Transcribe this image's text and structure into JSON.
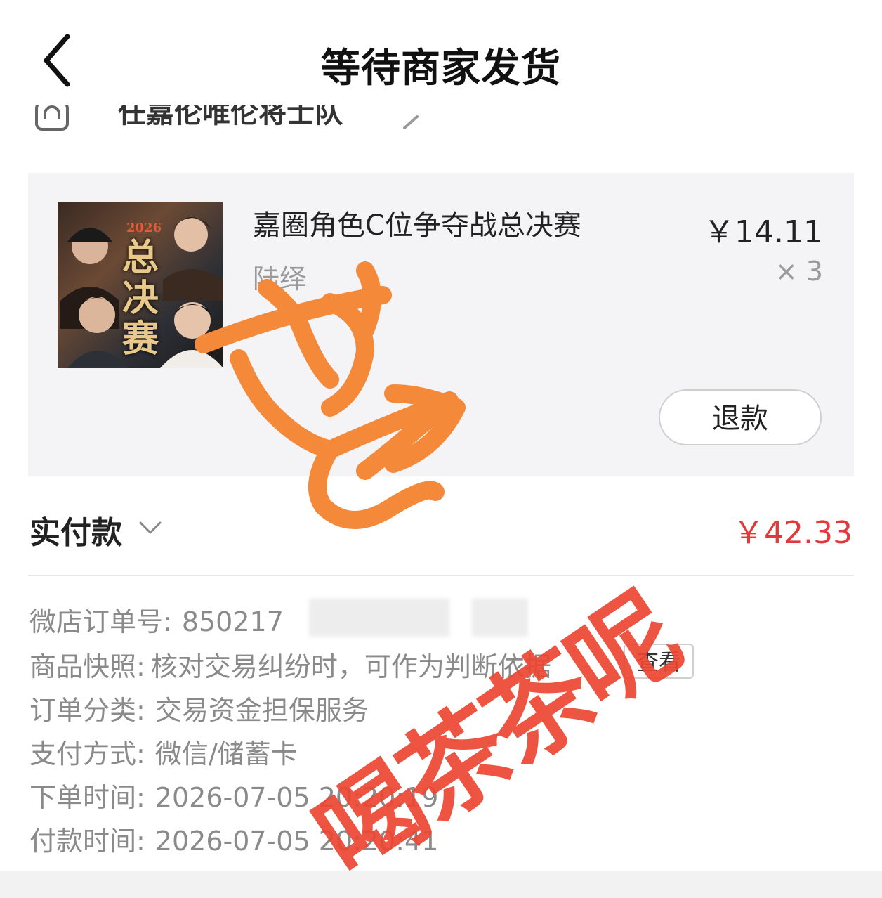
{
  "header": {
    "title": "等待商家发货"
  },
  "shop": {
    "name": "任嘉伦唯伦将士队"
  },
  "product": {
    "title": "嘉圈角色C位争夺战总决赛",
    "variant": "陆绎",
    "unit_price": "￥14.11",
    "quantity": "× 3",
    "refund_label": "退款",
    "thumb_year": "2026",
    "thumb_text": "总决赛"
  },
  "payment": {
    "label": "实付款",
    "amount": "￥42.33",
    "amount_color": "#e5383b"
  },
  "order_info": {
    "order_no": {
      "key": "微店订单号:",
      "value": "850217"
    },
    "snapshot": {
      "key": "商品快照:",
      "value": "核对交易纠纷时，可作为判断依据",
      "button": "查看"
    },
    "category": {
      "key": "订单分类:",
      "value": "交易资金担保服务"
    },
    "pay_method": {
      "key": "支付方式:",
      "value": "微信/储蓄卡"
    },
    "order_time": {
      "key": "下单时间:",
      "value": "2026-07-05 20:20:19"
    },
    "pay_time": {
      "key": "付款时间:",
      "value": "2026-07-05 20:20:41"
    }
  },
  "watermark": {
    "text": "喝茶茶呢",
    "scribble_color": "#f5893a"
  }
}
